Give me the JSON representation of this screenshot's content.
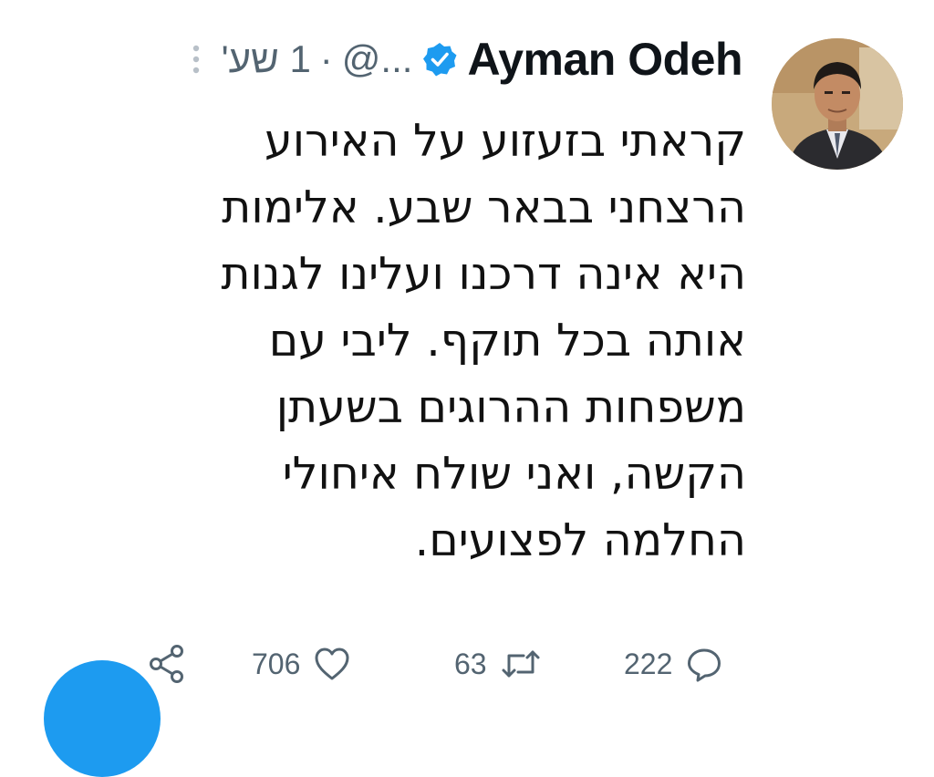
{
  "tweet": {
    "author": {
      "display_name": "Ayman Odeh",
      "verified": true,
      "handle": "@...",
      "separator": "·",
      "time": "1 שע'"
    },
    "body_lines": [
      "קראתי בזעזוע על האירוע",
      "הרצחני בבאר שבע. אלימות",
      "היא אינה דרכנו ועלינו לגנות",
      "אותה בכל תוקף. ליבי עם",
      "משפחות ההרוגים בשעתן",
      "הקשה, ואני שולח איחולי",
      "החלמה לפצועים."
    ],
    "actions": {
      "reply_count": "222",
      "retweet_count": "63",
      "like_count": "706",
      "icons": [
        "reply-icon",
        "retweet-icon",
        "like-icon",
        "share-icon"
      ]
    }
  },
  "colors": {
    "verified_badge": "#1d9bf0",
    "fab": "#1d9bf0",
    "secondary_text": "#536471",
    "primary_text": "#0f1419"
  }
}
